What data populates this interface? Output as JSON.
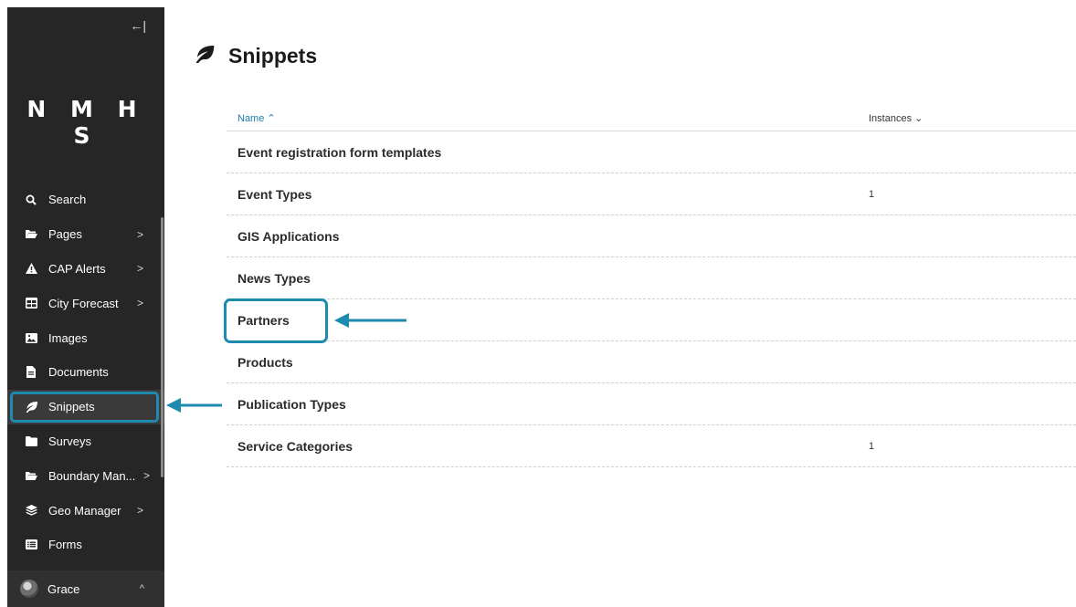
{
  "sidebar": {
    "collapse_icon": "←|",
    "logo": "N M H S",
    "items": [
      {
        "label": "Search",
        "icon": "search-icon",
        "glyph": "⚲",
        "chevron": ""
      },
      {
        "label": "Pages",
        "icon": "folder-open-icon",
        "glyph": "▰",
        "chevron": ">"
      },
      {
        "label": "CAP Alerts",
        "icon": "warning-icon",
        "glyph": "▲",
        "chevron": ">"
      },
      {
        "label": "City Forecast",
        "icon": "table-icon",
        "glyph": "▦",
        "chevron": ">"
      },
      {
        "label": "Images",
        "icon": "image-icon",
        "glyph": "▣",
        "chevron": ""
      },
      {
        "label": "Documents",
        "icon": "document-icon",
        "glyph": "▤",
        "chevron": ""
      },
      {
        "label": "Snippets",
        "icon": "leaf-icon",
        "glyph": "❦",
        "chevron": ""
      },
      {
        "label": "Surveys",
        "icon": "folder-icon",
        "glyph": "▬",
        "chevron": ""
      },
      {
        "label": "Boundary Man...",
        "icon": "folder-open-icon",
        "glyph": "▰",
        "chevron": ">"
      },
      {
        "label": "Geo Manager",
        "icon": "layers-icon",
        "glyph": "≋",
        "chevron": ">"
      },
      {
        "label": "Forms",
        "icon": "list-icon",
        "glyph": "▤",
        "chevron": ""
      }
    ],
    "user": {
      "name": "Grace",
      "chevron": "^"
    }
  },
  "main": {
    "title": "Snippets",
    "title_icon": "❦",
    "table": {
      "col_name": "Name ⌃",
      "col_instances": "Instances ⌄",
      "rows": [
        {
          "name": "Event registration form templates",
          "instances": ""
        },
        {
          "name": "Event Types",
          "instances": "1"
        },
        {
          "name": "GIS Applications",
          "instances": ""
        },
        {
          "name": "News Types",
          "instances": ""
        },
        {
          "name": "Partners",
          "instances": ""
        },
        {
          "name": "Products",
          "instances": ""
        },
        {
          "name": "Publication Types",
          "instances": ""
        },
        {
          "name": "Service Categories",
          "instances": "1"
        }
      ]
    }
  },
  "annotation_color": "#1f8ab0"
}
